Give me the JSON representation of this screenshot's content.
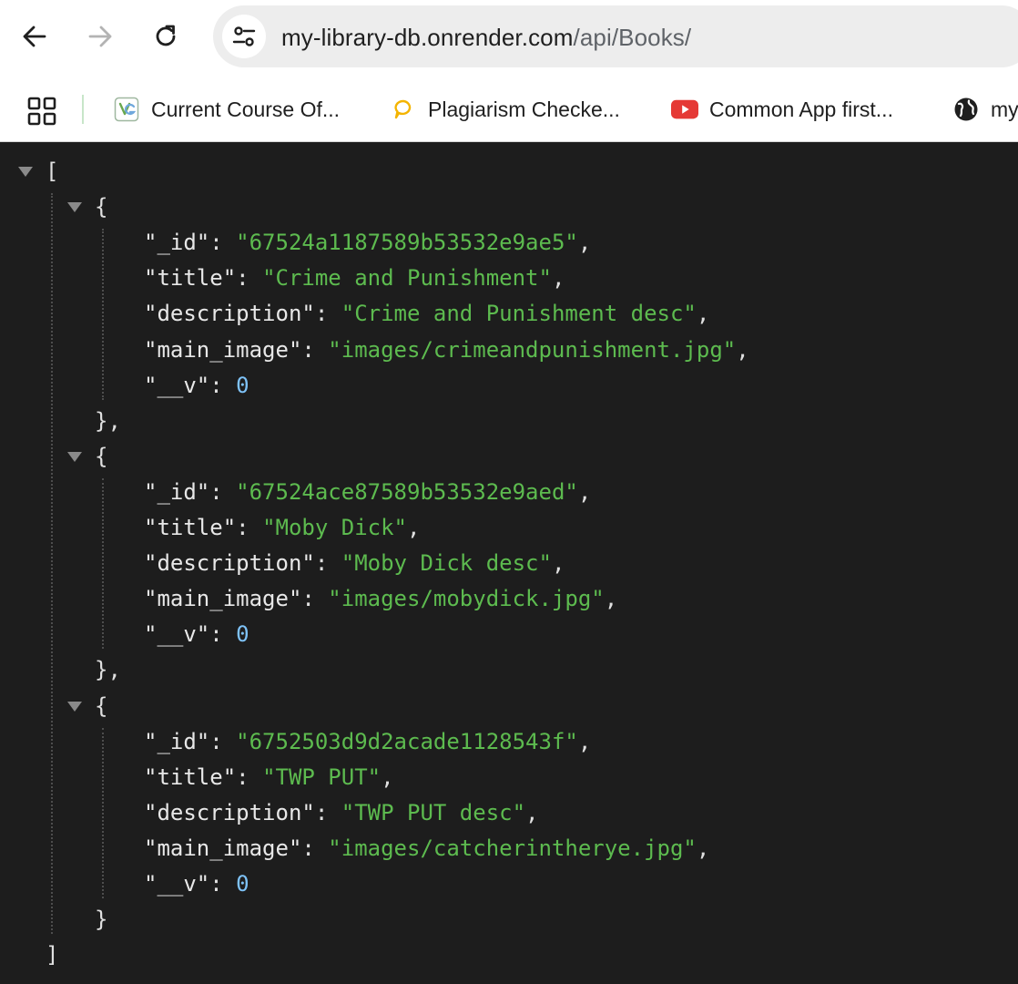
{
  "browser": {
    "url_host": "my-library-db.onrender.com",
    "url_path": "/api/Books/",
    "icons": {
      "back": "arrow-left-icon",
      "forward": "arrow-right-icon",
      "reload": "reload-icon",
      "site_info": "tune-icon"
    }
  },
  "bookmarks": [
    {
      "label": "Current Course Of...",
      "icon": "course-favicon",
      "color": "#6aa84f"
    },
    {
      "label": "Plagiarism Checke...",
      "icon": "chat-bubble-favicon",
      "color": "#f4b400"
    },
    {
      "label": "Common App first...",
      "icon": "youtube-favicon",
      "color": "#e53935"
    },
    {
      "label": "my",
      "icon": "globe-icon",
      "color": "#1f1f1f"
    }
  ],
  "json_viewer": {
    "open_bracket": "[",
    "close_bracket": "]",
    "items": [
      {
        "open": "{",
        "close": "},",
        "fields": [
          {
            "key": "\"_id\"",
            "value": "\"67524a1187589b53532e9ae5\"",
            "type": "string",
            "suffix": ","
          },
          {
            "key": "\"title\"",
            "value": "\"Crime and Punishment\"",
            "type": "string",
            "suffix": ","
          },
          {
            "key": "\"description\"",
            "value": "\"Crime and Punishment desc\"",
            "type": "string",
            "suffix": ","
          },
          {
            "key": "\"main_image\"",
            "value": "\"images/crimeandpunishment.jpg\"",
            "type": "string",
            "suffix": ","
          },
          {
            "key": "\"__v\"",
            "value": "0",
            "type": "number",
            "suffix": ""
          }
        ]
      },
      {
        "open": "{",
        "close": "},",
        "fields": [
          {
            "key": "\"_id\"",
            "value": "\"67524ace87589b53532e9aed\"",
            "type": "string",
            "suffix": ","
          },
          {
            "key": "\"title\"",
            "value": "\"Moby Dick\"",
            "type": "string",
            "suffix": ","
          },
          {
            "key": "\"description\"",
            "value": "\"Moby Dick desc\"",
            "type": "string",
            "suffix": ","
          },
          {
            "key": "\"main_image\"",
            "value": "\"images/mobydick.jpg\"",
            "type": "string",
            "suffix": ","
          },
          {
            "key": "\"__v\"",
            "value": "0",
            "type": "number",
            "suffix": ""
          }
        ]
      },
      {
        "open": "{",
        "close": "}",
        "fields": [
          {
            "key": "\"_id\"",
            "value": "\"6752503d9d2acade1128543f\"",
            "type": "string",
            "suffix": ","
          },
          {
            "key": "\"title\"",
            "value": "\"TWP PUT\"",
            "type": "string",
            "suffix": ","
          },
          {
            "key": "\"description\"",
            "value": "\"TWP PUT desc\"",
            "type": "string",
            "suffix": ","
          },
          {
            "key": "\"main_image\"",
            "value": "\"images/catcherintherye.jpg\"",
            "type": "string",
            "suffix": ","
          },
          {
            "key": "\"__v\"",
            "value": "0",
            "type": "number",
            "suffix": ""
          }
        ]
      }
    ]
  }
}
